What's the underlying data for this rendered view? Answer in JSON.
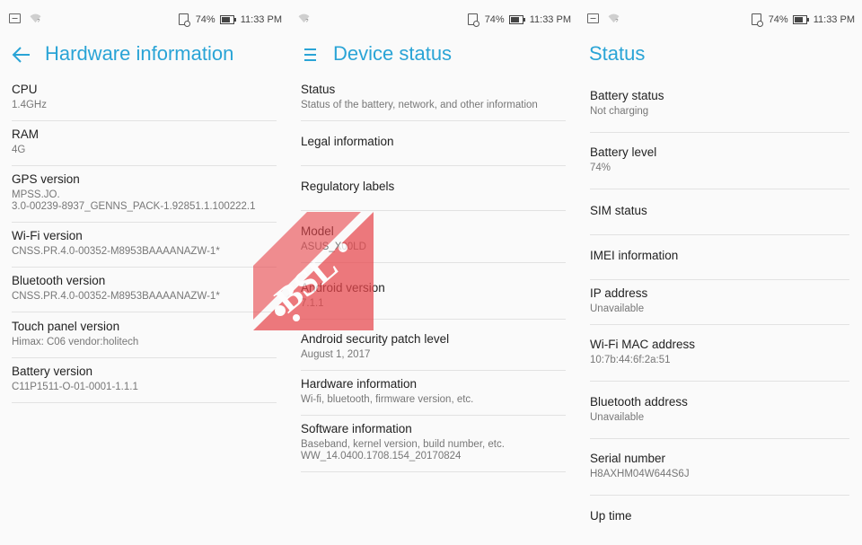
{
  "status_bar": {
    "battery": "74%",
    "time": "11:33 PM"
  },
  "panel1": {
    "title": "Hardware information",
    "items": [
      {
        "title": "CPU",
        "sub": "1.4GHz"
      },
      {
        "title": "RAM",
        "sub": "4G"
      },
      {
        "title": "GPS version",
        "sub": "MPSS.JO.\n3.0-00239-8937_GENNS_PACK-1.92851.1.100222.1"
      },
      {
        "title": "Wi-Fi version",
        "sub": "CNSS.PR.4.0-00352-M8953BAAAANAZW-1*"
      },
      {
        "title": "Bluetooth version",
        "sub": "CNSS.PR.4.0-00352-M8953BAAAANAZW-1*"
      },
      {
        "title": "Touch panel version",
        "sub": "Himax: C06 vendor:holitech"
      },
      {
        "title": "Battery version",
        "sub": "C11P1511-O-01-0001-1.1.1"
      }
    ]
  },
  "panel2": {
    "title": "Device status",
    "items": [
      {
        "title": "Status",
        "sub": "Status of the battery, network, and other information"
      },
      {
        "title": "Legal information",
        "sub": ""
      },
      {
        "title": "Regulatory labels",
        "sub": ""
      },
      {
        "title": "Model",
        "sub": "ASUS_X00LD"
      },
      {
        "title": "Android version",
        "sub": "7.1.1"
      },
      {
        "title": "Android security patch level",
        "sub": "August 1, 2017"
      },
      {
        "title": "Hardware information",
        "sub": "Wi-fi, bluetooth, firmware version, etc."
      },
      {
        "title": "Software information",
        "sub": "Baseband, kernel version, build number, etc.\nWW_14.0400.1708.154_20170824"
      }
    ]
  },
  "panel3": {
    "title": "Status",
    "items": [
      {
        "title": "Battery status",
        "sub": "Not charging"
      },
      {
        "title": "Battery level",
        "sub": "74%"
      },
      {
        "title": "SIM status",
        "sub": ""
      },
      {
        "title": "IMEI information",
        "sub": ""
      },
      {
        "title": "IP address",
        "sub": "Unavailable"
      },
      {
        "title": "Wi-Fi MAC address",
        "sub": "10:7b:44:6f:2a:51"
      },
      {
        "title": "Bluetooth address",
        "sub": "Unavailable"
      },
      {
        "title": "Serial number",
        "sub": "H8AXHM04W644S6J"
      },
      {
        "title": "Up time",
        "sub": ""
      }
    ]
  },
  "watermark": {
    "text": "BSL"
  },
  "colors": {
    "accent": "#2aa4d6",
    "watermark": "#e8474c"
  }
}
